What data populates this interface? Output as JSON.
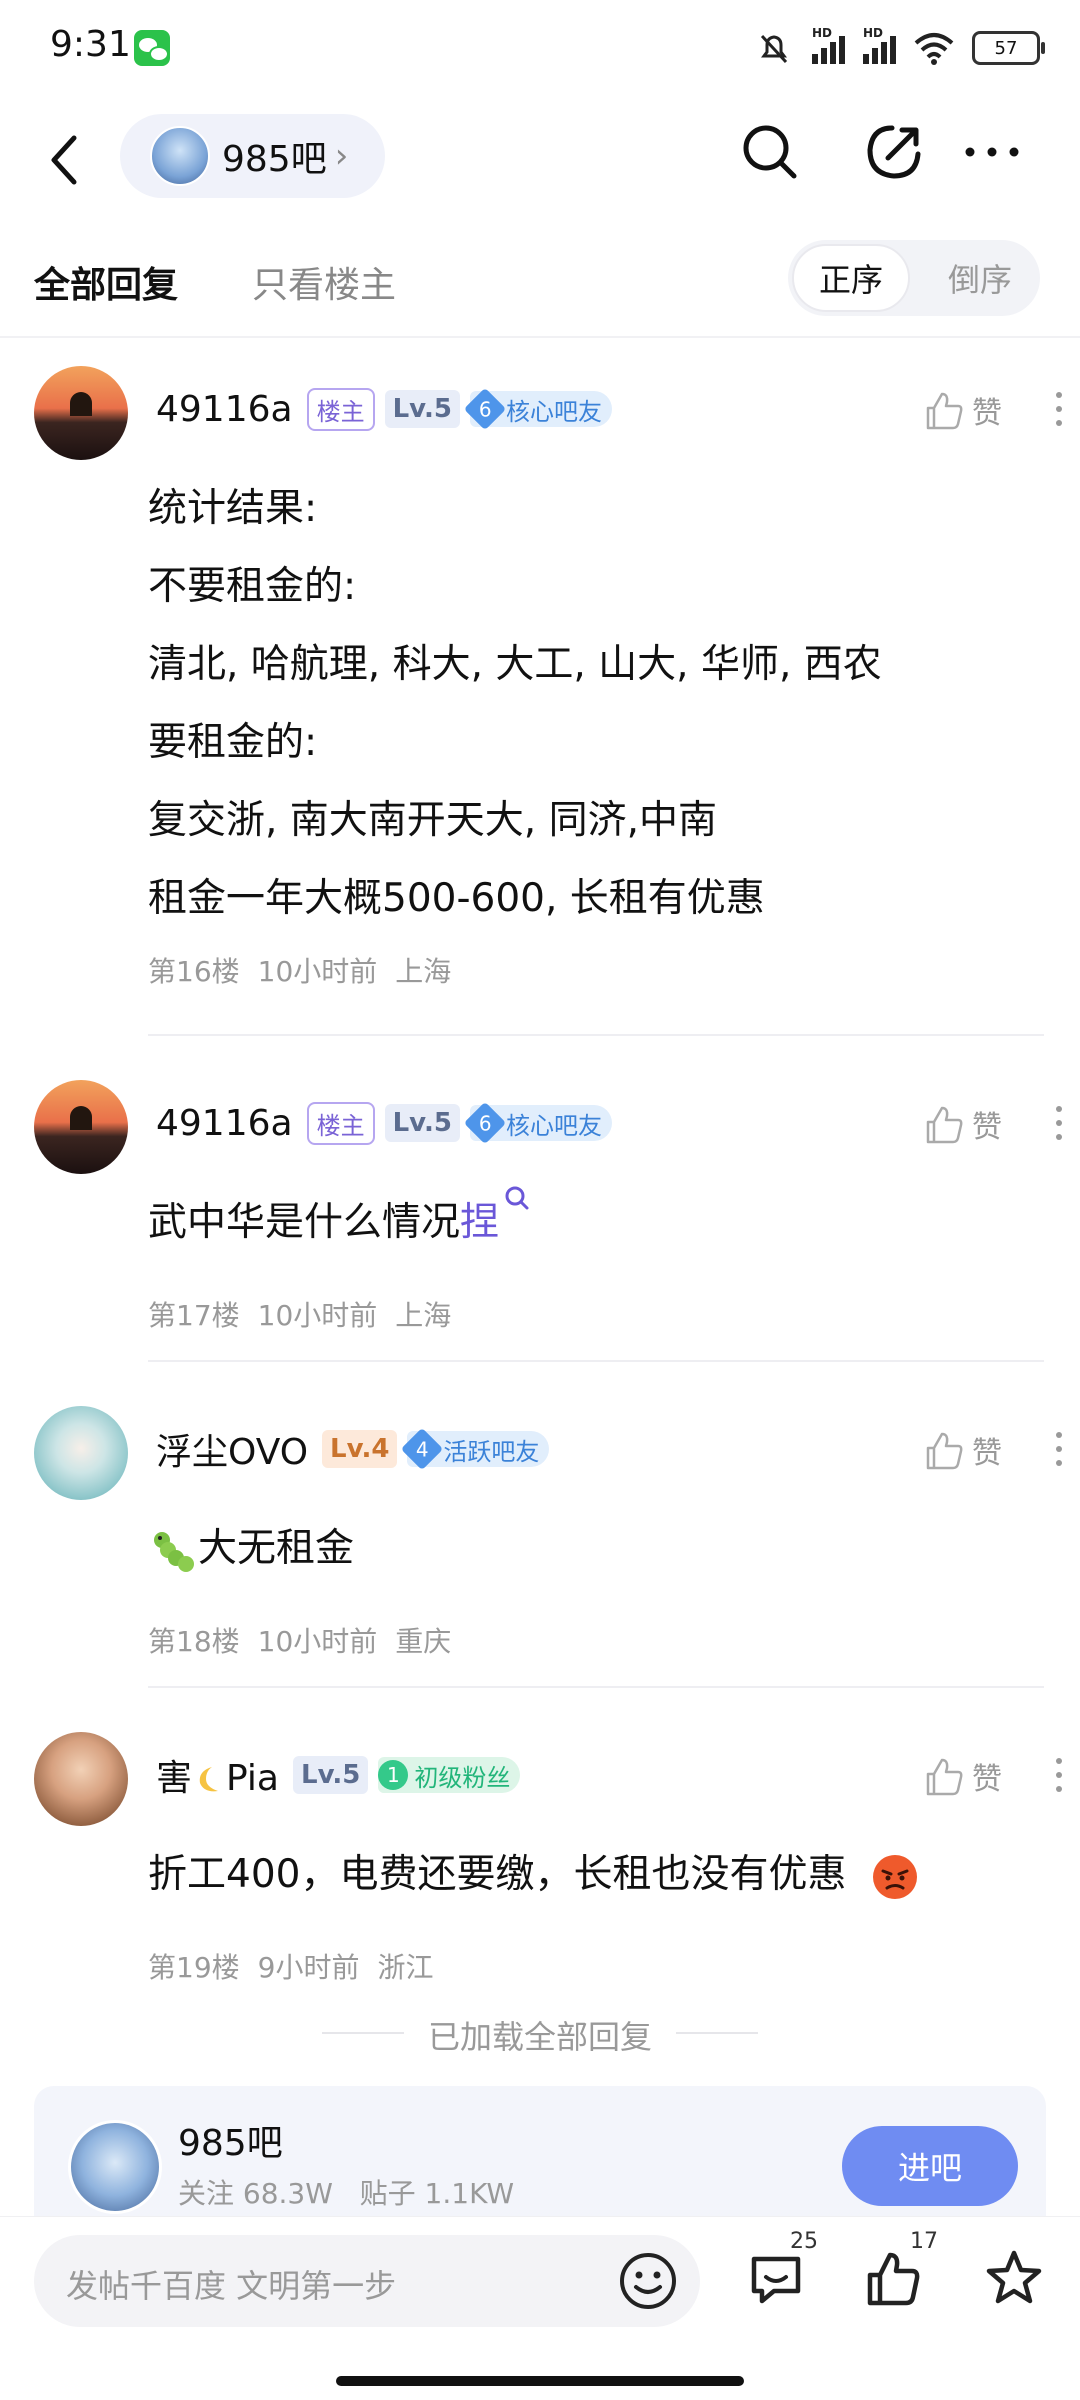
{
  "status_bar": {
    "time": "9:31",
    "battery": "57",
    "signal_tag": "HD"
  },
  "nav": {
    "forum_name": "985吧"
  },
  "tabs": {
    "all": "全部回复",
    "op_only": "只看楼主",
    "asc": "正序",
    "desc": "倒序"
  },
  "like_label": "赞",
  "posts": [
    {
      "username": "49116a",
      "op_badge": "楼主",
      "level": "Lv.5",
      "fan_level": "6",
      "fan_title": "核心吧友",
      "lines": [
        "统计结果:",
        "不要租金的:",
        "清北, 哈航理, 科大, 大工, 山大, 华师, 西农",
        "要租金的:",
        "复交浙, 南大南开天大, 同济,中南",
        "租金一年大概500-600, 长租有优惠"
      ],
      "floor": "第16楼",
      "time": "10小时前",
      "location": "上海"
    },
    {
      "username": "49116a",
      "op_badge": "楼主",
      "level": "Lv.5",
      "fan_level": "6",
      "fan_title": "核心吧友",
      "text": "武中华是什么情况",
      "link_word": "捏",
      "floor": "第17楼",
      "time": "10小时前",
      "location": "上海"
    },
    {
      "username": "浮尘OVO",
      "level": "Lv.4",
      "fan_level": "4",
      "fan_title": "活跃吧友",
      "text": "大无租金",
      "floor": "第18楼",
      "time": "10小时前",
      "location": "重庆"
    },
    {
      "username_prefix": "害",
      "username_suffix": "Pia",
      "level": "Lv.5",
      "fan_level": "1",
      "fan_title": "初级粉丝",
      "text": "折工400，电费还要缴，长租也没有优惠",
      "floor": "第19楼",
      "time": "9小时前",
      "location": "浙江"
    }
  ],
  "footer": {
    "all_loaded": "已加载全部回复",
    "forum_card": {
      "name": "985吧",
      "follow": "关注 68.3W",
      "posts": "贴子 1.1KW",
      "enter": "进吧"
    },
    "composer_placeholder": "发帖千百度 文明第一步",
    "comment_count": "25",
    "like_count": "17"
  },
  "colors": {
    "accent": "#6f8cf2",
    "link": "#6a57d8",
    "op_badge": "#7a63d6"
  }
}
